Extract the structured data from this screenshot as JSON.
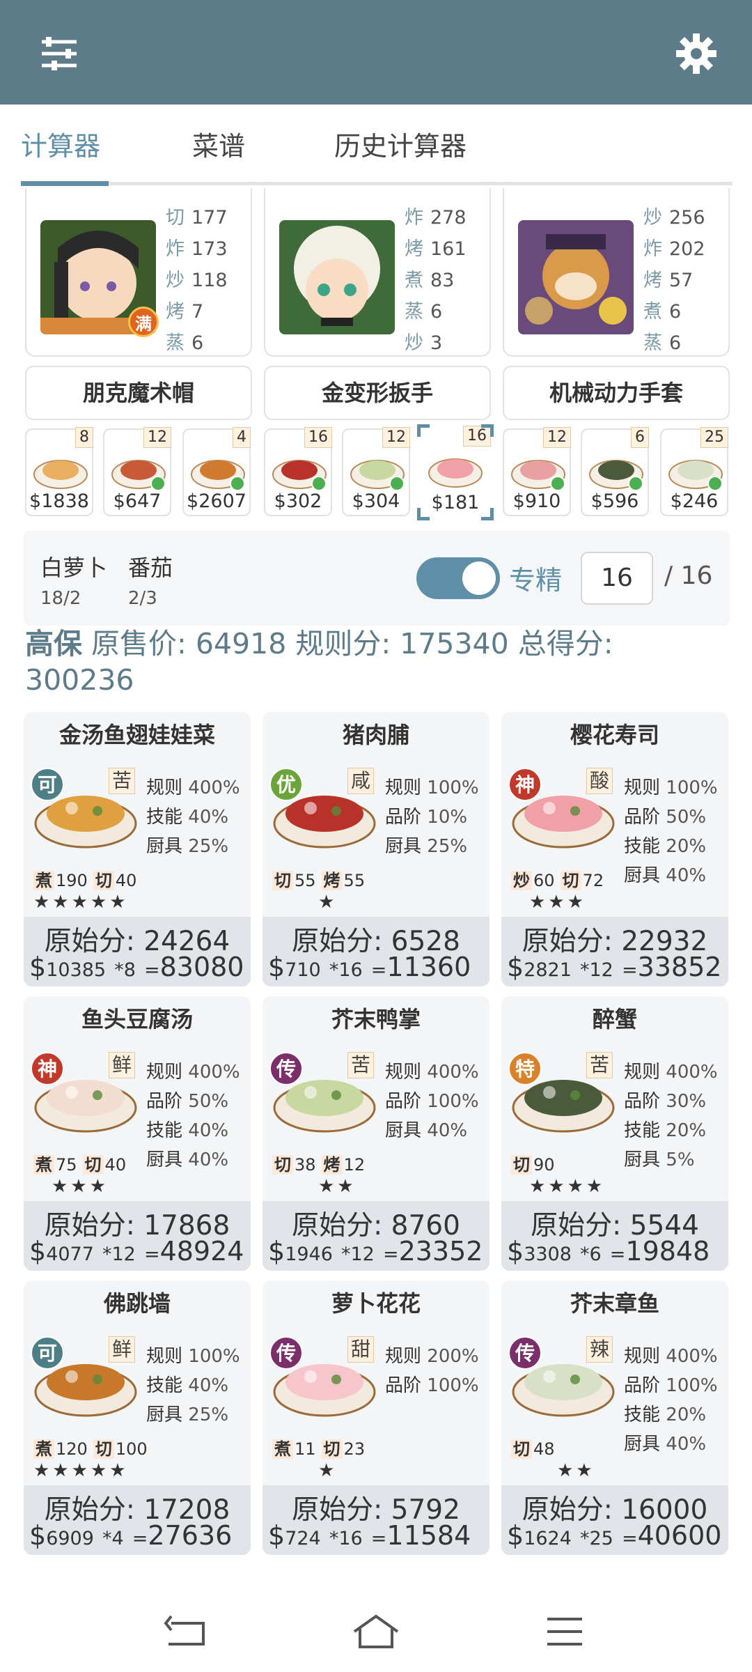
{
  "header": {
    "menu_icon": "sliders-icon",
    "settings_icon": "gear-icon",
    "color": "#5e7b8a"
  },
  "tabs": [
    {
      "label": "计算器",
      "active": true
    },
    {
      "label": "菜谱"
    },
    {
      "label": "历史计算器"
    }
  ],
  "chefs": [
    {
      "skills": [
        [
          "切",
          "177"
        ],
        [
          "炸",
          "173"
        ],
        [
          "炒",
          "118"
        ],
        [
          "烤",
          "7"
        ],
        [
          "蒸",
          "6"
        ]
      ],
      "badge": "满"
    },
    {
      "skills": [
        [
          "炸",
          "278"
        ],
        [
          "烤",
          "161"
        ],
        [
          "煮",
          "83"
        ],
        [
          "蒸",
          "6"
        ],
        [
          "炒",
          "3"
        ]
      ]
    },
    {
      "skills": [
        [
          "炒",
          "256"
        ],
        [
          "炸",
          "202"
        ],
        [
          "烤",
          "57"
        ],
        [
          "煮",
          "6"
        ],
        [
          "蒸",
          "6"
        ]
      ]
    }
  ],
  "equipment": [
    "朋克魔术帽",
    "金变形扳手",
    "机械动力手套"
  ],
  "slots": [
    {
      "count": "8",
      "price": "$1838"
    },
    {
      "count": "12",
      "price": "$647"
    },
    {
      "count": "4",
      "price": "$2607"
    },
    {
      "count": "16",
      "price": "$302"
    },
    {
      "count": "12",
      "price": "$304"
    },
    {
      "count": "16",
      "price": "$181"
    },
    {
      "count": "12",
      "price": "$910"
    },
    {
      "count": "6",
      "price": "$596"
    },
    {
      "count": "25",
      "price": "$246"
    }
  ],
  "ingredients": [
    {
      "name": "白萝卜",
      "qty": "18/2"
    },
    {
      "name": "番茄",
      "qty": "2/3"
    }
  ],
  "controls": {
    "toggle_label": "专精",
    "count": "16",
    "max": "/ 16"
  },
  "summary": {
    "level": "高保",
    "text": " 原售价:  64918 规则分:  175340 总得分:  300236"
  },
  "dishes": [
    {
      "name": "金汤鱼翅娃娃菜",
      "rarity": "可",
      "rcolor": "#4f7f86",
      "flavor": "苦",
      "bonuses": [
        [
          "规则",
          "400%"
        ],
        [
          "技能",
          "40%"
        ],
        [
          "厨具",
          "25%"
        ]
      ],
      "req": [
        [
          "煮",
          "190"
        ],
        [
          "切",
          "40"
        ]
      ],
      "stars": "★★★★★",
      "raw": "原始分: 24264",
      "price": "$",
      "unit": "10385",
      "mult": "*8",
      "eq": "=",
      "total": "83080",
      "food": "#e0a040"
    },
    {
      "name": "猪肉脯",
      "rarity": "优",
      "rcolor": "#6aa43a",
      "flavor": "咸",
      "bonuses": [
        [
          "规则",
          "100%"
        ],
        [
          "品阶",
          "10%"
        ],
        [
          "厨具",
          "25%"
        ]
      ],
      "req": [
        [
          "切",
          "55"
        ],
        [
          "烤",
          "55"
        ]
      ],
      "stars": "★",
      "raw": "原始分: 6528",
      "price": "$",
      "unit": "710",
      "mult": "*16",
      "eq": "=",
      "total": "11360",
      "food": "#b8322a"
    },
    {
      "name": "樱花寿司",
      "rarity": "神",
      "rcolor": "#c0392b",
      "flavor": "酸",
      "bonuses": [
        [
          "规则",
          "100%"
        ],
        [
          "品阶",
          "50%"
        ],
        [
          "技能",
          "20%"
        ],
        [
          "厨具",
          "40%"
        ]
      ],
      "req": [
        [
          "炒",
          "60"
        ],
        [
          "切",
          "72"
        ]
      ],
      "stars": "★★★",
      "raw": "原始分: 22932",
      "price": "$",
      "unit": "2821",
      "mult": "*12",
      "eq": "=",
      "total": "33852",
      "food": "#f2a0a8"
    },
    {
      "name": "鱼头豆腐汤",
      "rarity": "神",
      "rcolor": "#c0392b",
      "flavor": "鲜",
      "bonuses": [
        [
          "规则",
          "400%"
        ],
        [
          "品阶",
          "50%"
        ],
        [
          "技能",
          "40%"
        ],
        [
          "厨具",
          "40%"
        ]
      ],
      "req": [
        [
          "煮",
          "75"
        ],
        [
          "切",
          "40"
        ]
      ],
      "stars": "★★★",
      "raw": "原始分: 17868",
      "price": "$",
      "unit": "4077",
      "mult": "*12",
      "eq": "=",
      "total": "48924",
      "food": "#f3ddd0"
    },
    {
      "name": "芥末鸭掌",
      "rarity": "传",
      "rcolor": "#7a2f6b",
      "flavor": "苦",
      "bonuses": [
        [
          "规则",
          "400%"
        ],
        [
          "品阶",
          "100%"
        ],
        [
          "厨具",
          "40%"
        ]
      ],
      "req": [
        [
          "切",
          "38"
        ],
        [
          "烤",
          "12"
        ]
      ],
      "stars": "★★",
      "raw": "原始分: 8760",
      "price": "$",
      "unit": "1946",
      "mult": "*12",
      "eq": "=",
      "total": "23352",
      "food": "#c8d8a0"
    },
    {
      "name": "醉蟹",
      "rarity": "特",
      "rcolor": "#d9822b",
      "flavor": "苦",
      "bonuses": [
        [
          "规则",
          "400%"
        ],
        [
          "品阶",
          "30%"
        ],
        [
          "技能",
          "20%"
        ],
        [
          "厨具",
          "5%"
        ]
      ],
      "req": [
        [
          "切",
          "90"
        ]
      ],
      "stars": "★★★★",
      "raw": "原始分: 5544",
      "price": "$",
      "unit": "3308",
      "mult": "*6",
      "eq": "=",
      "total": "19848",
      "food": "#4a5a3a"
    },
    {
      "name": "佛跳墙",
      "rarity": "可",
      "rcolor": "#4f7f86",
      "flavor": "鲜",
      "bonuses": [
        [
          "规则",
          "100%"
        ],
        [
          "技能",
          "40%"
        ],
        [
          "厨具",
          "25%"
        ]
      ],
      "req": [
        [
          "煮",
          "120"
        ],
        [
          "切",
          "100"
        ]
      ],
      "stars": "★★★★★",
      "raw": "原始分: 17208",
      "price": "$",
      "unit": "6909",
      "mult": "*4",
      "eq": "=",
      "total": "27636",
      "food": "#c8782a"
    },
    {
      "name": "萝卜花花",
      "rarity": "传",
      "rcolor": "#7a2f6b",
      "flavor": "甜",
      "bonuses": [
        [
          "规则",
          "200%"
        ],
        [
          "品阶",
          "100%"
        ]
      ],
      "req": [
        [
          "煮",
          "11"
        ],
        [
          "切",
          "23"
        ]
      ],
      "stars": "★",
      "raw": "原始分: 5792",
      "price": "$",
      "unit": "724",
      "mult": "*16",
      "eq": "=",
      "total": "11584",
      "food": "#f6c6cc"
    },
    {
      "name": "芥末章鱼",
      "rarity": "传",
      "rcolor": "#7a2f6b",
      "flavor": "辣",
      "bonuses": [
        [
          "规则",
          "400%"
        ],
        [
          "品阶",
          "100%"
        ],
        [
          "技能",
          "20%"
        ],
        [
          "厨具",
          "40%"
        ]
      ],
      "req": [
        [
          "切",
          "48"
        ]
      ],
      "stars": "★★",
      "raw": "原始分: 16000",
      "price": "$",
      "unit": "1624",
      "mult": "*25",
      "eq": "=",
      "total": "40600",
      "food": "#d8e0c8"
    }
  ],
  "navbar": {
    "back_icon": "back-icon",
    "home_icon": "home-icon",
    "menu_icon": "menu-icon"
  }
}
